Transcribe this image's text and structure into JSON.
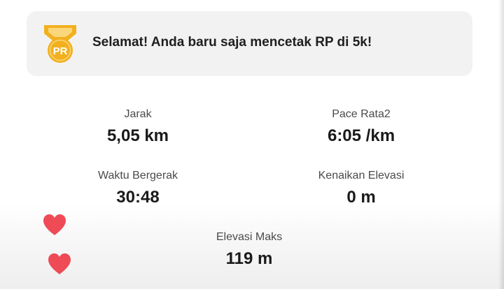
{
  "pr_banner": {
    "badge_text": "PR",
    "message": "Selamat! Anda baru saja mencetak RP di 5k!",
    "badge_color": "#F2B01E"
  },
  "stats": {
    "distance": {
      "label": "Jarak",
      "value": "5,05 km"
    },
    "avg_pace": {
      "label": "Pace Rata2",
      "value": "6:05 /km"
    },
    "moving_time": {
      "label": "Waktu Bergerak",
      "value": "30:48"
    },
    "elevation_gain": {
      "label": "Kenaikan Elevasi",
      "value": "0 m"
    },
    "max_elevation": {
      "label": "Elevasi Maks",
      "value": "119 m"
    }
  },
  "reactions": {
    "icon": "heart-icon",
    "color": "#EE4B57"
  }
}
